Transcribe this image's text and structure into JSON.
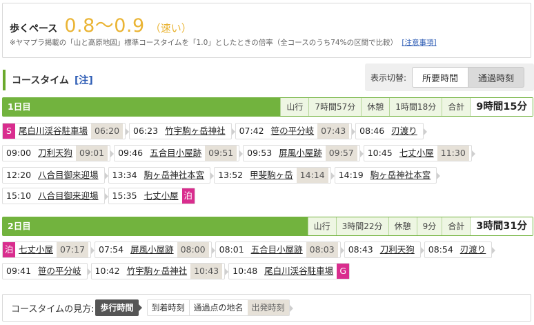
{
  "pace": {
    "label": "歩くペース",
    "value": "0.8〜0.9",
    "desc": "（速い）",
    "note": "※ヤマプラ掲載の「山と高原地図」標準コースタイムを「1.0」としたときの倍率（全コースのうち74%の区間で比較）",
    "note_link": "[注意事項]"
  },
  "course_time": {
    "title": "コースタイム",
    "note": "[注]"
  },
  "toggle": {
    "label": "表示切替:",
    "option1": "所要時間",
    "option2": "通過時刻"
  },
  "days": [
    {
      "label": "1日目",
      "stats": {
        "move_label": "山行",
        "move": "7時間57分",
        "rest_label": "休憩",
        "rest": "1時間18分",
        "total_label": "合計",
        "total": "9時間15分"
      },
      "rows": [
        [
          {
            "badge": "S",
            "place": "尾白川渓谷駐車場",
            "dep": "06:20"
          },
          {
            "arr": "06:23",
            "place": "竹宇駒ヶ岳神社"
          },
          {
            "arr": "07:42",
            "place": "笹の平分岐",
            "dep": "07:43"
          },
          {
            "arr": "08:46",
            "place": "刃渡り"
          }
        ],
        [
          {
            "arr": "09:00",
            "place": "刀利天狗",
            "dep": "09:01"
          },
          {
            "arr": "09:46",
            "place": "五合目小屋跡",
            "dep": "09:51"
          },
          {
            "arr": "09:53",
            "place": "屏風小屋跡",
            "dep": "09:57"
          },
          {
            "arr": "10:45",
            "place": "七丈小屋",
            "dep": "11:30"
          }
        ],
        [
          {
            "arr": "12:20",
            "place": "八合目御来迎場"
          },
          {
            "arr": "13:34",
            "place": "駒ヶ岳神社本宮"
          },
          {
            "arr": "13:52",
            "place": "甲斐駒ヶ岳",
            "dep": "14:14"
          },
          {
            "arr": "14:19",
            "place": "駒ヶ岳神社本宮"
          }
        ],
        [
          {
            "arr": "15:10",
            "place": "八合目御来迎場"
          },
          {
            "arr": "15:35",
            "place": "七丈小屋",
            "end_badge": "泊"
          }
        ]
      ]
    },
    {
      "label": "2日目",
      "stats": {
        "move_label": "山行",
        "move": "3時間22分",
        "rest_label": "休憩",
        "rest": "9分",
        "total_label": "合計",
        "total": "3時間31分"
      },
      "rows": [
        [
          {
            "badge": "泊",
            "place": "七丈小屋",
            "dep": "07:17"
          },
          {
            "arr": "07:54",
            "place": "屏風小屋跡",
            "dep": "08:00"
          },
          {
            "arr": "08:01",
            "place": "五合目小屋跡",
            "dep": "08:03"
          },
          {
            "arr": "08:43",
            "place": "刀利天狗"
          },
          {
            "arr": "08:54",
            "place": "刃渡り"
          }
        ],
        [
          {
            "arr": "09:41",
            "place": "笹の平分岐"
          },
          {
            "arr": "10:42",
            "place": "竹宇駒ヶ岳神社",
            "dep": "10:43"
          },
          {
            "arr": "10:48",
            "place": "尾白川渓谷駐車場",
            "end_badge": "G"
          }
        ]
      ]
    }
  ],
  "legend": {
    "title": "コースタイムの見方:",
    "walk": "歩行時間",
    "arrive": "到着時刻",
    "place": "通過点の地名",
    "depart": "出発時刻"
  },
  "colors": {
    "accent_green": "#72b33e",
    "pace_yellow": "#eab434",
    "badge_pink": "#d92d8e",
    "link_blue": "#2c5bb4"
  }
}
